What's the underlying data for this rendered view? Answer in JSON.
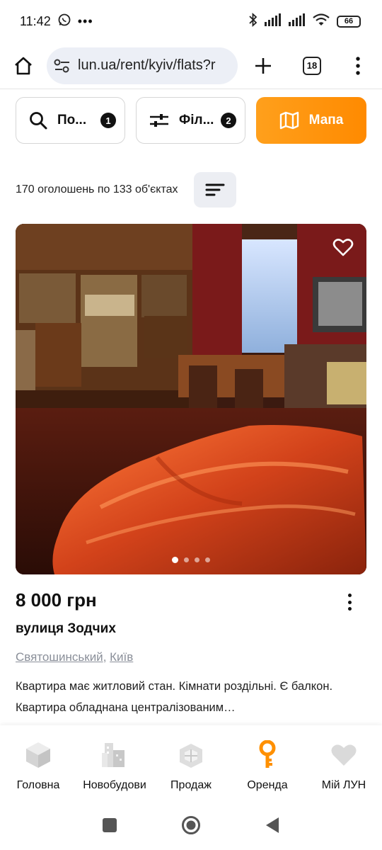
{
  "status_bar": {
    "time": "11:42",
    "notification_icons": [
      "whatsapp-icon",
      "more-dots-icon"
    ],
    "system_icons": [
      "bluetooth-icon",
      "signal-icon",
      "signal-icon",
      "wifi-icon"
    ],
    "battery": "66"
  },
  "browser": {
    "url": "lun.ua/rent/kyiv/flats?r",
    "tab_count": "18"
  },
  "filters": {
    "search_label": "По...",
    "search_count": "1",
    "filters_label": "Філ...",
    "filters_count": "2",
    "map_label": "Мапа"
  },
  "results": {
    "summary": "170 оголошень по 133 об'єктах"
  },
  "listing": {
    "photo_count": 4,
    "active_photo": 1,
    "price": "8 000 грн",
    "street": "вулиця Зодчих",
    "district": "Святошинський",
    "separator": ", ",
    "city": "Київ",
    "description": "Квартира має житловий стан. Кімнати роздільні. Є балкон. Квартира обладнана централізованим…"
  },
  "bottom_nav": [
    {
      "label": "Головна",
      "icon": "cube-icon"
    },
    {
      "label": "Новобудови",
      "icon": "buildings-icon"
    },
    {
      "label": "Продаж",
      "icon": "floorplan-icon"
    },
    {
      "label": "Оренда",
      "icon": "key-icon",
      "active": true
    },
    {
      "label": "Мій ЛУН",
      "icon": "heart-icon"
    }
  ],
  "colors": {
    "accent": "#ff9000",
    "muted_text": "#8a8f99",
    "nav_icon": "#d9d9d9"
  }
}
